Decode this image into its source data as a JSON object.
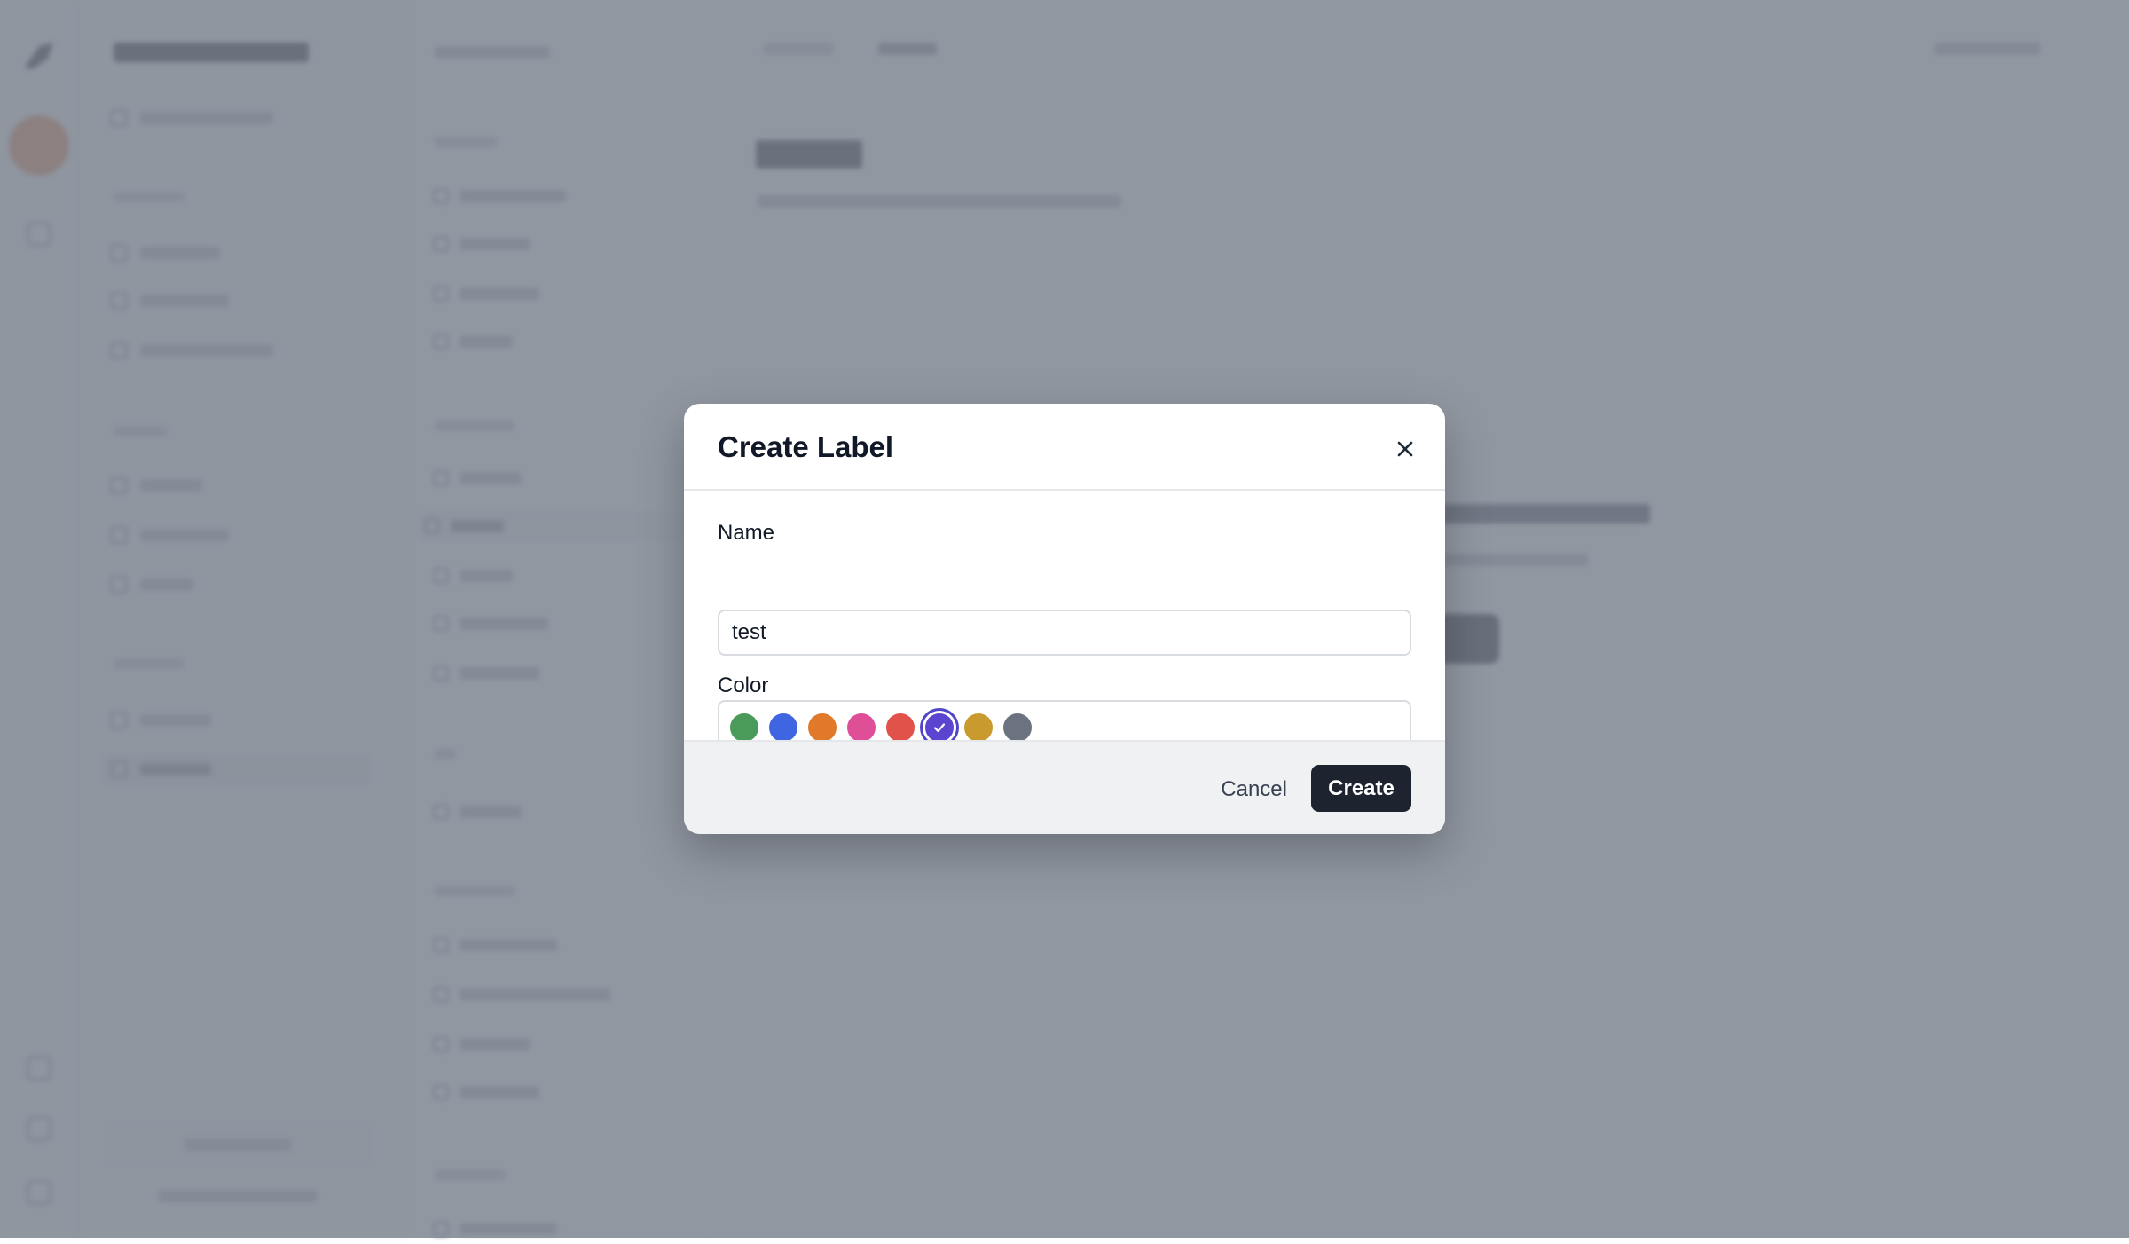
{
  "modal": {
    "title": "Create Label",
    "name_label": "Name",
    "name_value": "test",
    "color_label": "Color",
    "colors": [
      {
        "name": "green",
        "hex": "#4a9a5a",
        "selected": false
      },
      {
        "name": "blue",
        "hex": "#3f66e0",
        "selected": false
      },
      {
        "name": "orange",
        "hex": "#e07a2a",
        "selected": false
      },
      {
        "name": "pink",
        "hex": "#df4f98",
        "selected": false
      },
      {
        "name": "red",
        "hex": "#e0524a",
        "selected": false
      },
      {
        "name": "purple",
        "hex": "#5b44cf",
        "selected": true
      },
      {
        "name": "gold",
        "hex": "#c99a2e",
        "selected": false
      },
      {
        "name": "gray",
        "hex": "#6b7280",
        "selected": false
      }
    ],
    "cancel_label": "Cancel",
    "create_label": "Create",
    "close_icon": "close-icon"
  },
  "colors": {
    "overlay": "rgba(120,128,140,0.82)",
    "primary_button": "#1e2330",
    "selected_ring": "#4f46c8"
  }
}
